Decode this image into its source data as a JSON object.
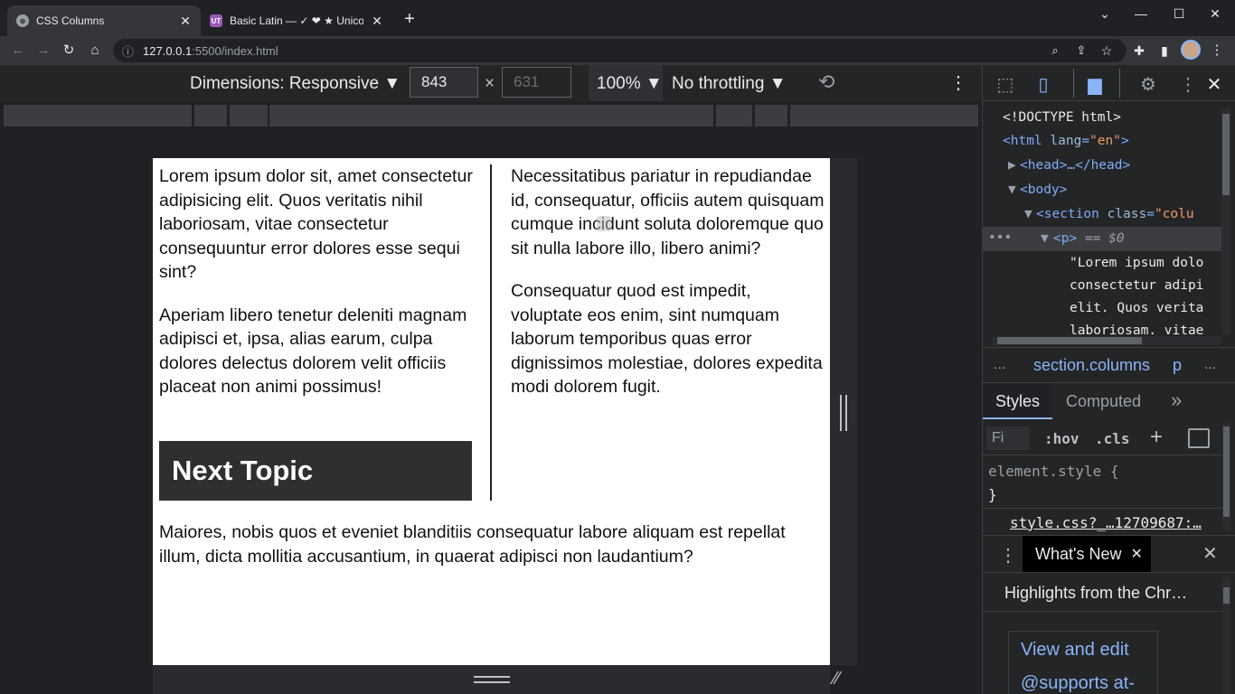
{
  "tabs": [
    {
      "title": "CSS Columns",
      "icon": "globe-icon",
      "active": true
    },
    {
      "title": "Basic Latin — ✓ ❤ ★ Unicode",
      "icon": "ut-icon",
      "active": false
    }
  ],
  "new_tab_label": "+",
  "address": {
    "host": "127.0.0.1",
    "path": ":5500/index.html"
  },
  "device_toolbar": {
    "dimensions_label": "Dimensions: Responsive",
    "width": "843",
    "height": "631",
    "times": "×",
    "zoom": "100%",
    "throttling": "No throttling"
  },
  "page": {
    "left_col": {
      "p1": "Lorem ipsum dolor sit, amet consectetur adipisicing elit. Quos veritatis nihil laboriosam, vitae consectetur consequuntur error dolores esse sequi sint?",
      "p2": "Aperiam libero tenetur deleniti magnam adipisci et, ipsa, alias earum, culpa dolores delectus dolorem velit officiis placeat non animi possimus!",
      "heading": "Next Topic"
    },
    "right_col": {
      "p1": "Necessitatibus pariatur in repudiandae id, consequatur, officiis autem quisquam cumque incidunt soluta doloremque quo sit nulla labore illo, libero animi?",
      "p2": "Consequatur quod est impedit, voluptate eos enim, sint numquam laborum temporibus quas error dignissimos molestiae, dolores expedita modi dolorem fugit."
    },
    "footer_p": "Maiores, nobis quos et eveniet blanditiis consequatur labore aliquam est repellat illum, dicta mollitia accusantium, in quaerat adipisci non laudantium?"
  },
  "devtools": {
    "dom": {
      "doctype": "<!DOCTYPE html>",
      "html_open": "<html",
      "html_attr": "lang",
      "html_val": "\"en\"",
      "html_close": ">",
      "head": "<head>…</head>",
      "body": "<body>",
      "section_open": "<section",
      "section_attr": "class",
      "section_val": "\"colu",
      "p_line": "<p>",
      "p_eq": "== $0",
      "text1": "\"Lorem ipsum dolo",
      "text2": "consectetur adipi",
      "text3": "elit. Quos verita",
      "text4": "laboriosam, vitae"
    },
    "breadcrumb": {
      "more": "...",
      "section": "section.columns",
      "p": "p",
      "more_right": "..."
    },
    "tabs": {
      "styles": "Styles",
      "computed": "Computed",
      "more": "»"
    },
    "filter": {
      "placeholder": "Fi",
      "hov": ":hov",
      "cls": ".cls",
      "add": "+"
    },
    "element_style": "element.style {",
    "element_style_close": "}",
    "stylesheet_link": "style.css?_…12709687:…",
    "drawer": {
      "tab": "What's New",
      "highlights": "Highlights from the Chr…",
      "card1": "View and edit",
      "card2": "@supports at-"
    }
  },
  "colors": {
    "accent": "#8ab4f8",
    "chrome_dark": "#202124",
    "toolbar": "#35363a"
  }
}
